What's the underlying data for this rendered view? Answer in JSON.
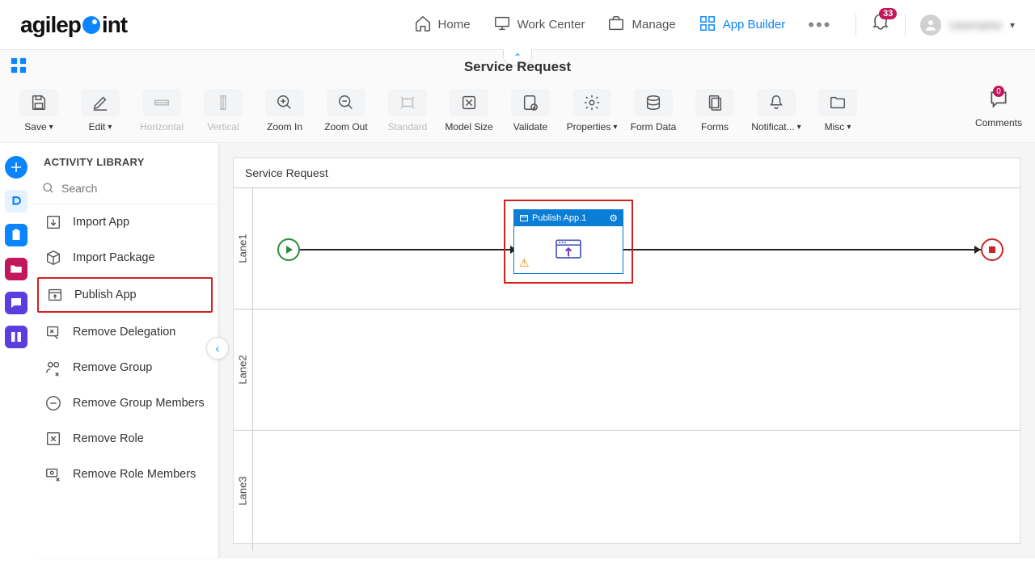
{
  "nav": {
    "home": "Home",
    "work_center": "Work Center",
    "manage": "Manage",
    "app_builder": "App Builder",
    "notifications_count": "33",
    "user_name": "Username"
  },
  "page": {
    "title": "Service Request"
  },
  "toolbar": {
    "save": "Save",
    "edit": "Edit",
    "horizontal": "Horizontal",
    "vertical": "Vertical",
    "zoom_in": "Zoom In",
    "zoom_out": "Zoom Out",
    "standard": "Standard",
    "model_size": "Model Size",
    "validate": "Validate",
    "properties": "Properties",
    "form_data": "Form Data",
    "forms": "Forms",
    "notifications": "Notificat...",
    "misc": "Misc",
    "comments": "Comments",
    "comments_count": "0"
  },
  "sidebar": {
    "title": "ACTIVITY LIBRARY",
    "search_placeholder": "Search",
    "items": [
      {
        "label": "Import App"
      },
      {
        "label": "Import Package"
      },
      {
        "label": "Publish App",
        "highlighted": true
      },
      {
        "label": "Remove Delegation"
      },
      {
        "label": "Remove Group"
      },
      {
        "label": "Remove Group Members"
      },
      {
        "label": "Remove Role"
      },
      {
        "label": "Remove Role Members"
      }
    ]
  },
  "canvas": {
    "title": "Service Request",
    "lanes": [
      "Lane1",
      "Lane2",
      "Lane3"
    ],
    "activity": {
      "title": "Publish App.1"
    }
  }
}
